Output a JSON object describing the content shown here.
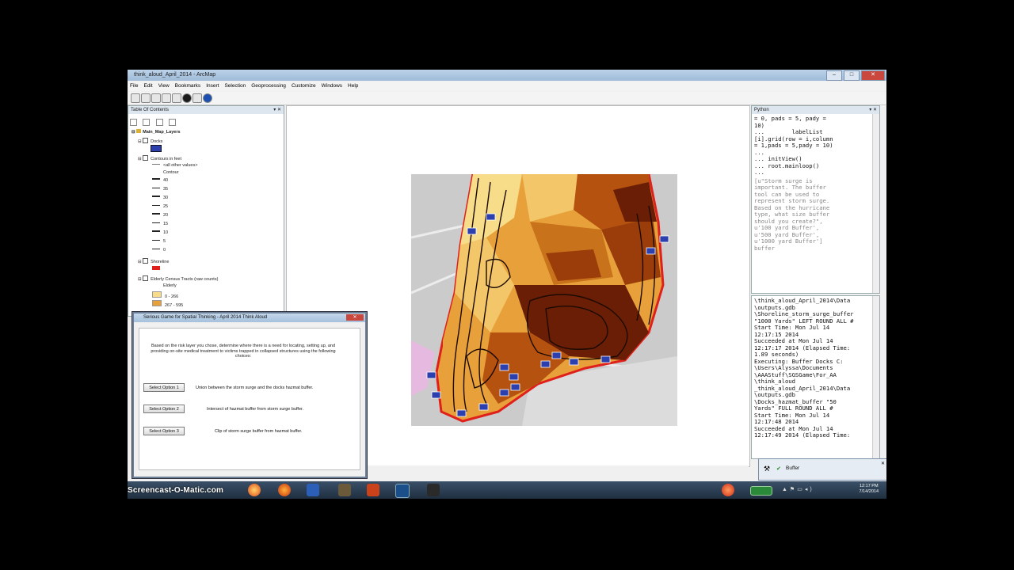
{
  "window": {
    "title": "think_aloud_April_2014 - ArcMap"
  },
  "menu": [
    "File",
    "Edit",
    "View",
    "Bookmarks",
    "Insert",
    "Selection",
    "Geoprocessing",
    "Customize",
    "Windows",
    "Help"
  ],
  "toc": {
    "title": "Table Of Contents",
    "root": "Main_Map_Layers",
    "layers": [
      {
        "label": "Docks"
      },
      {
        "label": "Contours in feet"
      },
      {
        "label": "<all other values>"
      },
      {
        "label": "Contour"
      },
      {
        "label": "40"
      },
      {
        "label": "35"
      },
      {
        "label": "30"
      },
      {
        "label": "25"
      },
      {
        "label": "20"
      },
      {
        "label": "15"
      },
      {
        "label": "10"
      },
      {
        "label": "5"
      },
      {
        "label": "0"
      },
      {
        "label": "Shoreline"
      },
      {
        "label": "Elderly Census Tracts (raw counts)"
      },
      {
        "label": "Elderly"
      },
      {
        "label": "0 - 266"
      },
      {
        "label": "267 - 595"
      }
    ]
  },
  "python": {
    "title": "Python",
    "code_top": "= 0, pads = 5, pady =\n10)\n...        labelList\n[i].grid(row = i,column\n= 1,pads = 5,pady = 10)\n...\n... initView()\n... root.mainloop()\n...",
    "code_grey": "[u\"Storm surge is\nimportant. The buffer\ntool can be used to\nrepresent storm surge.\nBased on the hurricane\ntype, what size buffer\nshould you create?\",\nu'100 yard Buffer',\nu'500 yard Buffer',\nu'1000 yard Buffer']\nbuffer",
    "output": "\\think_aloud_April_2014\\Data\n\\outputs.gdb\n\\Shoreline_storm_surge_buffer\n\"1000 Yards\" LEFT ROUND ALL #\nStart Time: Mon Jul 14\n12:17:15 2014\nSucceeded at Mon Jul 14\n12:17:17 2014 (Elapsed Time:\n1.89 seconds)\nExecuting: Buffer Docks C:\n\\Users\\Alyssa\\Documents\n\\AAAStuff\\SGSGame\\For_AA\n\\think_aloud\n_think_aloud_April_2014\\Data\n\\outputs.gdb\n\\Docks_hazmat_buffer \"50\nYards\" FULL ROUND ALL #\nStart Time: Mon Jul 14\n12:17:48 2014\nSucceeded at Mon Jul 14\n12:17:49 2014 (Elapsed Time:"
  },
  "dialog": {
    "title": "Serious Game for Spatial Thinking - April 2014 Think Aloud",
    "message": "Based on the risk layer you chose, determine where there is a need for locating, setting up, and providing on-site medical treatment to victims trapped in collapsed structures using the following choices:",
    "options": [
      {
        "button": "Select Option 1",
        "label": "Union between the storm surge and the docks hazmat buffer."
      },
      {
        "button": "Select Option 2",
        "label": "Intersect of hazmat buffer from storm surge buffer."
      },
      {
        "button": "Select Option 3",
        "label": "Clip of storm surge buffer from hazmat buffer."
      }
    ]
  },
  "notification": {
    "label": "Buffer"
  },
  "taskbar": {
    "watermark": "Screencast-O-Matic.com",
    "time": "12:17 PM",
    "date": "7/14/2014"
  },
  "colors": {
    "accent_dark": "#6a1e05",
    "accent_mid": "#b5520f",
    "accent_light": "#e8a13a",
    "pale": "#f7dc8a",
    "shoreline": "#e0201a",
    "water": "#c9c9c9",
    "dock": "#2b3fae"
  }
}
